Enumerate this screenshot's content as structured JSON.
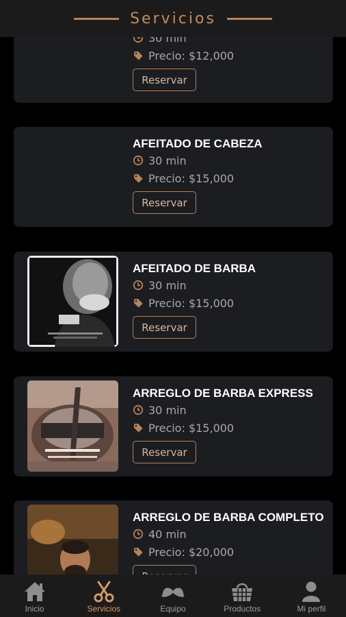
{
  "header": {
    "title": "Servicios"
  },
  "services": [
    {
      "name": "",
      "duration": "30 min",
      "price": "Precio: $12,000",
      "button": "Reservar"
    },
    {
      "name": "AFEITADO DE CABEZA",
      "duration": "30 min",
      "price": "Precio: $15,000",
      "button": "Reservar"
    },
    {
      "name": "AFEITADO DE BARBA",
      "duration": "30 min",
      "price": "Precio: $15,000",
      "button": "Reservar"
    },
    {
      "name": "ARREGLO DE BARBA EXPRESS",
      "duration": "30 min",
      "price": "Precio: $15,000",
      "button": "Reservar"
    },
    {
      "name": "ARREGLO DE BARBA COMPLETO",
      "duration": "40 min",
      "price": "Precio: $20,000",
      "button": "Reservar"
    }
  ],
  "nav": {
    "items": [
      {
        "label": "Inicio",
        "icon": "home-icon"
      },
      {
        "label": "Servicios",
        "icon": "scissors-icon",
        "active": true
      },
      {
        "label": "Equipo",
        "icon": "mustache-icon"
      },
      {
        "label": "Productos",
        "icon": "basket-icon"
      },
      {
        "label": "Mi perfil",
        "icon": "user-icon"
      }
    ]
  },
  "colors": {
    "accent": "#c38d5e",
    "card": "#1c1d21",
    "bar": "#1b1b1b",
    "nav_inactive": "#9d9d9d"
  }
}
